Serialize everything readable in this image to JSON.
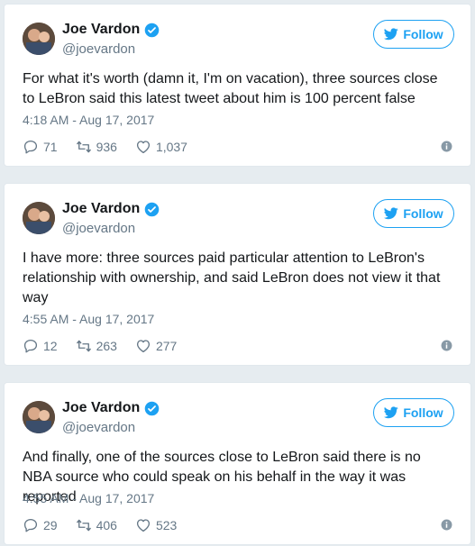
{
  "tweets": [
    {
      "name": "Joe Vardon",
      "handle": "@joevardon",
      "follow_label": "Follow",
      "text": "For what it's worth (damn it, I'm on vacation), three sources close to LeBron said this latest tweet about him is 100 percent false",
      "timestamp": "4:18 AM - Aug 17, 2017",
      "replies": "71",
      "retweets": "936",
      "likes": "1,037"
    },
    {
      "name": "Joe Vardon",
      "handle": "@joevardon",
      "follow_label": "Follow",
      "text": "I have more: three sources paid particular attention to LeBron's relationship with ownership, and said LeBron does not view it that way",
      "timestamp": "4:55 AM - Aug 17, 2017",
      "replies": "12",
      "retweets": "263",
      "likes": "277"
    },
    {
      "name": "Joe Vardon",
      "handle": "@joevardon",
      "follow_label": "Follow",
      "text": "And finally, one of the sources close to LeBron said there is no NBA source who could speak on his behalf in the way it was reported",
      "timestamp": "4:55 AM - Aug 17, 2017",
      "replies": "29",
      "retweets": "406",
      "likes": "523"
    }
  ],
  "icons": {
    "verified": "verified-badge-icon",
    "follow": "twitter-bird-icon",
    "reply": "reply-icon",
    "retweet": "retweet-icon",
    "like": "heart-icon",
    "info": "info-icon"
  },
  "colors": {
    "accent": "#1da1f2",
    "text": "#14171a",
    "muted": "#657786",
    "border": "#e1e8ed",
    "background": "#e6ecf0"
  }
}
